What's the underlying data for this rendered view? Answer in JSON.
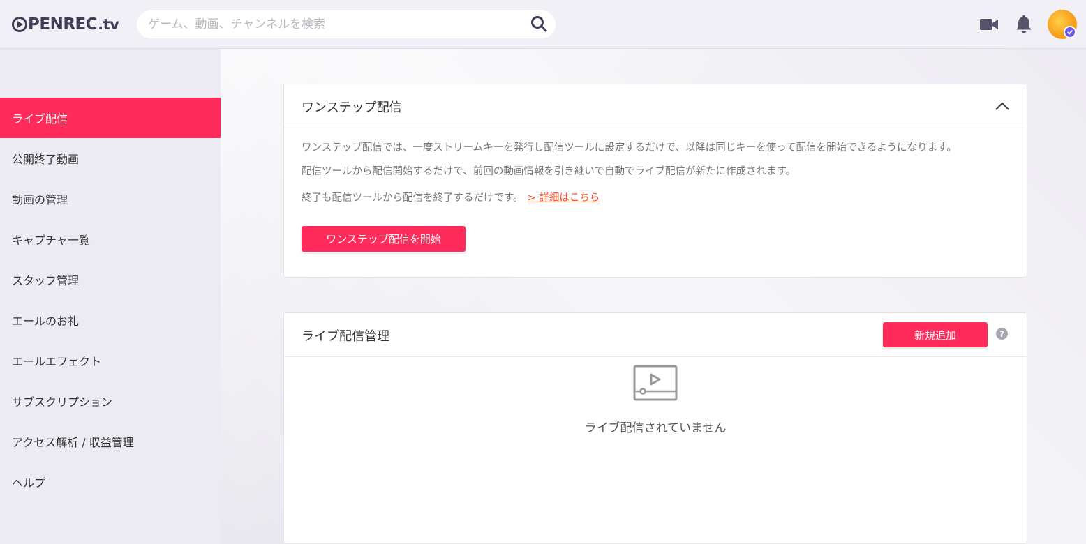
{
  "header": {
    "logo_main": "PENREC",
    "logo_tv": ".tv",
    "search_placeholder": "ゲーム、動画、チャンネルを検索"
  },
  "sidebar": {
    "items": [
      {
        "label": "ライブ配信",
        "active": true
      },
      {
        "label": "公開終了動画"
      },
      {
        "label": "動画の管理"
      },
      {
        "label": "キャプチャ一覧"
      },
      {
        "label": "スタッフ管理"
      },
      {
        "label": "エールのお礼"
      },
      {
        "label": "エールエフェクト"
      },
      {
        "label": "サブスクリプション"
      },
      {
        "label": "アクセス解析 / 収益管理"
      },
      {
        "label": "ヘルプ"
      }
    ]
  },
  "onestep": {
    "title": "ワンステップ配信",
    "desc1": "ワンステップ配信では、一度ストリームキーを発行し配信ツールに設定するだけで、以降は同じキーを使って配信を開始できるようになります。",
    "desc2": "配信ツールから配信開始するだけで、前回の動画情報を引き継いで自動でライブ配信が新たに作成されます。",
    "desc3": "終了も配信ツールから配信を終了するだけです。",
    "detail_link": "> 詳細はこちら",
    "start_button": "ワンステップ配信を開始"
  },
  "live_manage": {
    "title": "ライブ配信管理",
    "add_button": "新規追加",
    "help": "?",
    "empty_text": "ライブ配信されていません"
  },
  "colors": {
    "accent": "#ff2b5a",
    "link": "#ff4c2b",
    "logo": "#3f3e58",
    "sidebar_bg": "#eceaf2"
  }
}
